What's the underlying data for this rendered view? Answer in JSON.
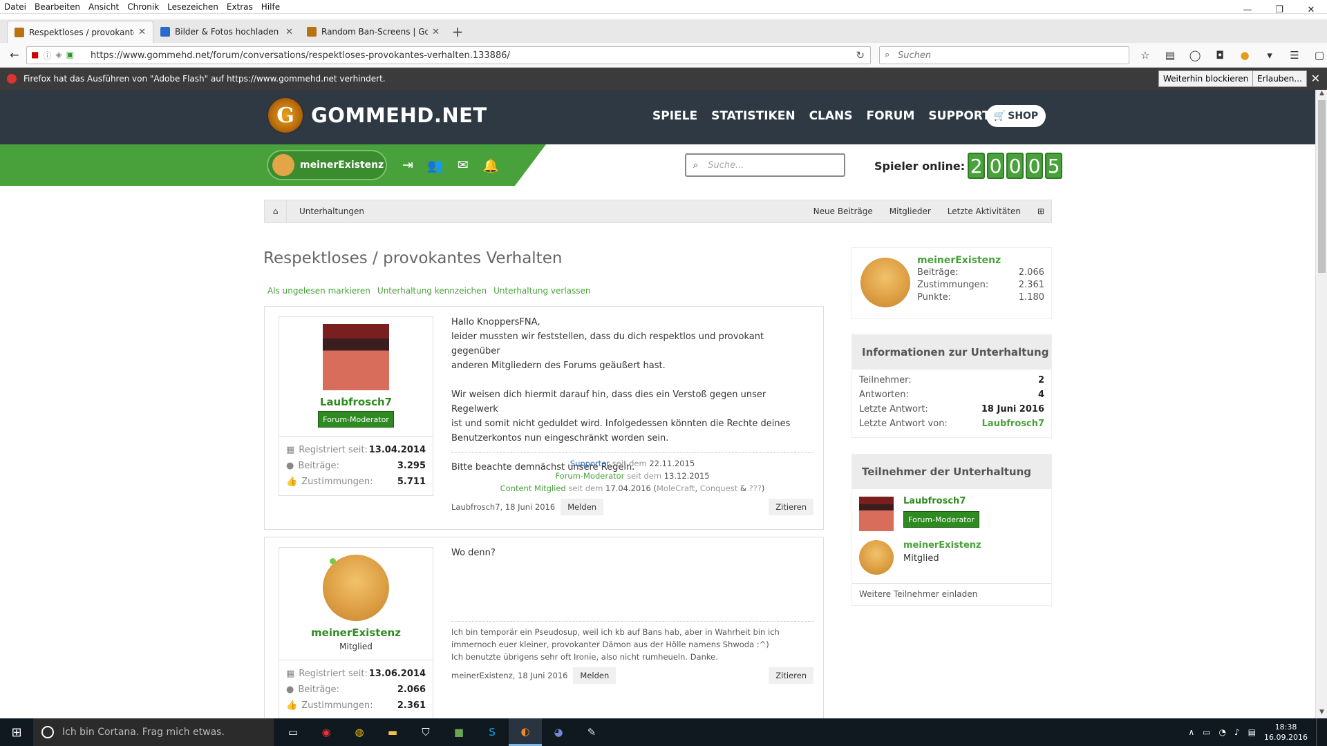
{
  "browser": {
    "menu": [
      "Datei",
      "Bearbeiten",
      "Ansicht",
      "Chronik",
      "Lesezeichen",
      "Extras",
      "Hilfe"
    ],
    "tabs": [
      {
        "label": "Respektloses / provokante...",
        "icon_color": "#b8720e",
        "active": true
      },
      {
        "label": "Bilder & Fotos hochladen",
        "icon_color": "#2a6ac9",
        "active": false
      },
      {
        "label": "Random Ban-Screens | Go...",
        "icon_color": "#b8720e",
        "active": false
      }
    ],
    "url": "https://www.gommehd.net/forum/conversations/respektloses-provokantes-verhalten.133886/",
    "search_placeholder": "Suchen",
    "notification": {
      "text": "Firefox hat das Ausführen von \"Adobe Flash\" auf https://www.gommehd.net verhindert.",
      "block_btn": "Weiterhin blockieren",
      "allow_btn": "Erlauben..."
    }
  },
  "site": {
    "logo_text": "GOMMEHD.NET",
    "logo_letter": "G",
    "nav": [
      "SPIELE",
      "STATISTIKEN",
      "CLANS",
      "FORUM",
      "SUPPORT"
    ],
    "shop_label": "SHOP",
    "user": "meinerExistenz",
    "search_placeholder": "Suche...",
    "online_label": "Spieler online:",
    "online_digits": [
      "2",
      "0",
      "0",
      "0",
      "5"
    ]
  },
  "breadcrumb": {
    "crumb": "Unterhaltungen",
    "links": [
      "Neue Beiträge",
      "Mitglieder",
      "Letzte Aktivitäten"
    ]
  },
  "page": {
    "title": "Respektloses / provokantes Verhalten",
    "actions": [
      "Als ungelesen markieren",
      "Unterhaltung kennzeichen",
      "Unterhaltung verlassen"
    ]
  },
  "posts": [
    {
      "user": "Laubfrosch7",
      "role": "Forum-Moderator",
      "stats": [
        {
          "k": "Registriert seit:",
          "v": "13.04.2014"
        },
        {
          "k": "Beiträge:",
          "v": "3.295"
        },
        {
          "k": "Zustimmungen:",
          "v": "5.711"
        }
      ],
      "body_p1_l1": "Hallo KnoppersFNA,",
      "body_p1_l2": "leider mussten wir feststellen, dass du dich respektlos und provokant gegenüber",
      "body_p1_l3": "anderen Mitgliedern des Forums geäußert hast.",
      "body_p2_l1": "Wir weisen dich hiermit darauf hin, dass dies ein Verstoß gegen unser Regelwerk",
      "body_p2_l2": "ist und somit nicht geduldet wird. Infolgedessen könnten die Rechte deines",
      "body_p2_l3": "Benutzerkontos nun eingeschränkt worden sein.",
      "body_p3": "Bitte beachte demnächst unsere Regeln.",
      "sig": {
        "r1_role": "Supporter",
        "r1_mid": "seit dem",
        "r1_date": "22.11.2015",
        "r2_role": "Forum-Moderator",
        "r2_mid": "seit dem",
        "r2_date": "13.12.2015",
        "r3_role": "Content Mitglied",
        "r3_mid": "seit dem",
        "r3_date": "17.04.2016",
        "r3_open": "(",
        "r3_a": "MoleCraft",
        "r3_sep": ",",
        "r3_b": "Conquest",
        "r3_amp": "&",
        "r3_c": "???",
        "r3_close": ")"
      },
      "meta": "Laubfrosch7, 18 Juni 2016",
      "report": "Melden",
      "quote": "Zitieren"
    },
    {
      "user": "meinerExistenz",
      "role": "Mitglied",
      "stats": [
        {
          "k": "Registriert seit:",
          "v": "13.06.2014"
        },
        {
          "k": "Beiträge:",
          "v": "2.066"
        },
        {
          "k": "Zustimmungen:",
          "v": "2.361"
        }
      ],
      "body": "Wo denn?",
      "sig_l1": "Ich bin temporär ein Pseudosup, weil ich kb auf Bans hab, aber in Wahrheit bin ich",
      "sig_l2": "immernoch euer kleiner, provokanter Dämon aus der Hölle namens Shwoda :^)",
      "sig_l3": "Ich benutzte übrigens sehr oft Ironie, also nicht rumheueln. Danke.",
      "meta": "meinerExistenz, 18 Juni 2016",
      "report": "Melden",
      "quote": "Zitieren"
    }
  ],
  "sidebar": {
    "profile": {
      "name": "meinerExistenz",
      "rows": [
        {
          "k": "Beiträge:",
          "v": "2.066"
        },
        {
          "k": "Zustimmungen:",
          "v": "2.361"
        },
        {
          "k": "Punkte:",
          "v": "1.180"
        }
      ]
    },
    "info": {
      "title": "Informationen zur Unterhaltung",
      "rows": [
        {
          "k": "Teilnehmer:",
          "v": "2"
        },
        {
          "k": "Antworten:",
          "v": "4"
        },
        {
          "k": "Letzte Antwort:",
          "v": "18 Juni 2016"
        },
        {
          "k": "Letzte Antwort von:",
          "v": "Laubfrosch7"
        }
      ]
    },
    "participants": {
      "title": "Teilnehmer der Unterhaltung",
      "p1_name": "Laubfrosch7",
      "p1_role": "Forum-Moderator",
      "p2_name": "meinerExistenz",
      "p2_role": "Mitglied",
      "invite": "Weitere Teilnehmer einladen"
    }
  },
  "taskbar": {
    "cortana": "Ich bin Cortana. Frag mich etwas.",
    "time": "18:38",
    "date": "16.09.2016"
  }
}
